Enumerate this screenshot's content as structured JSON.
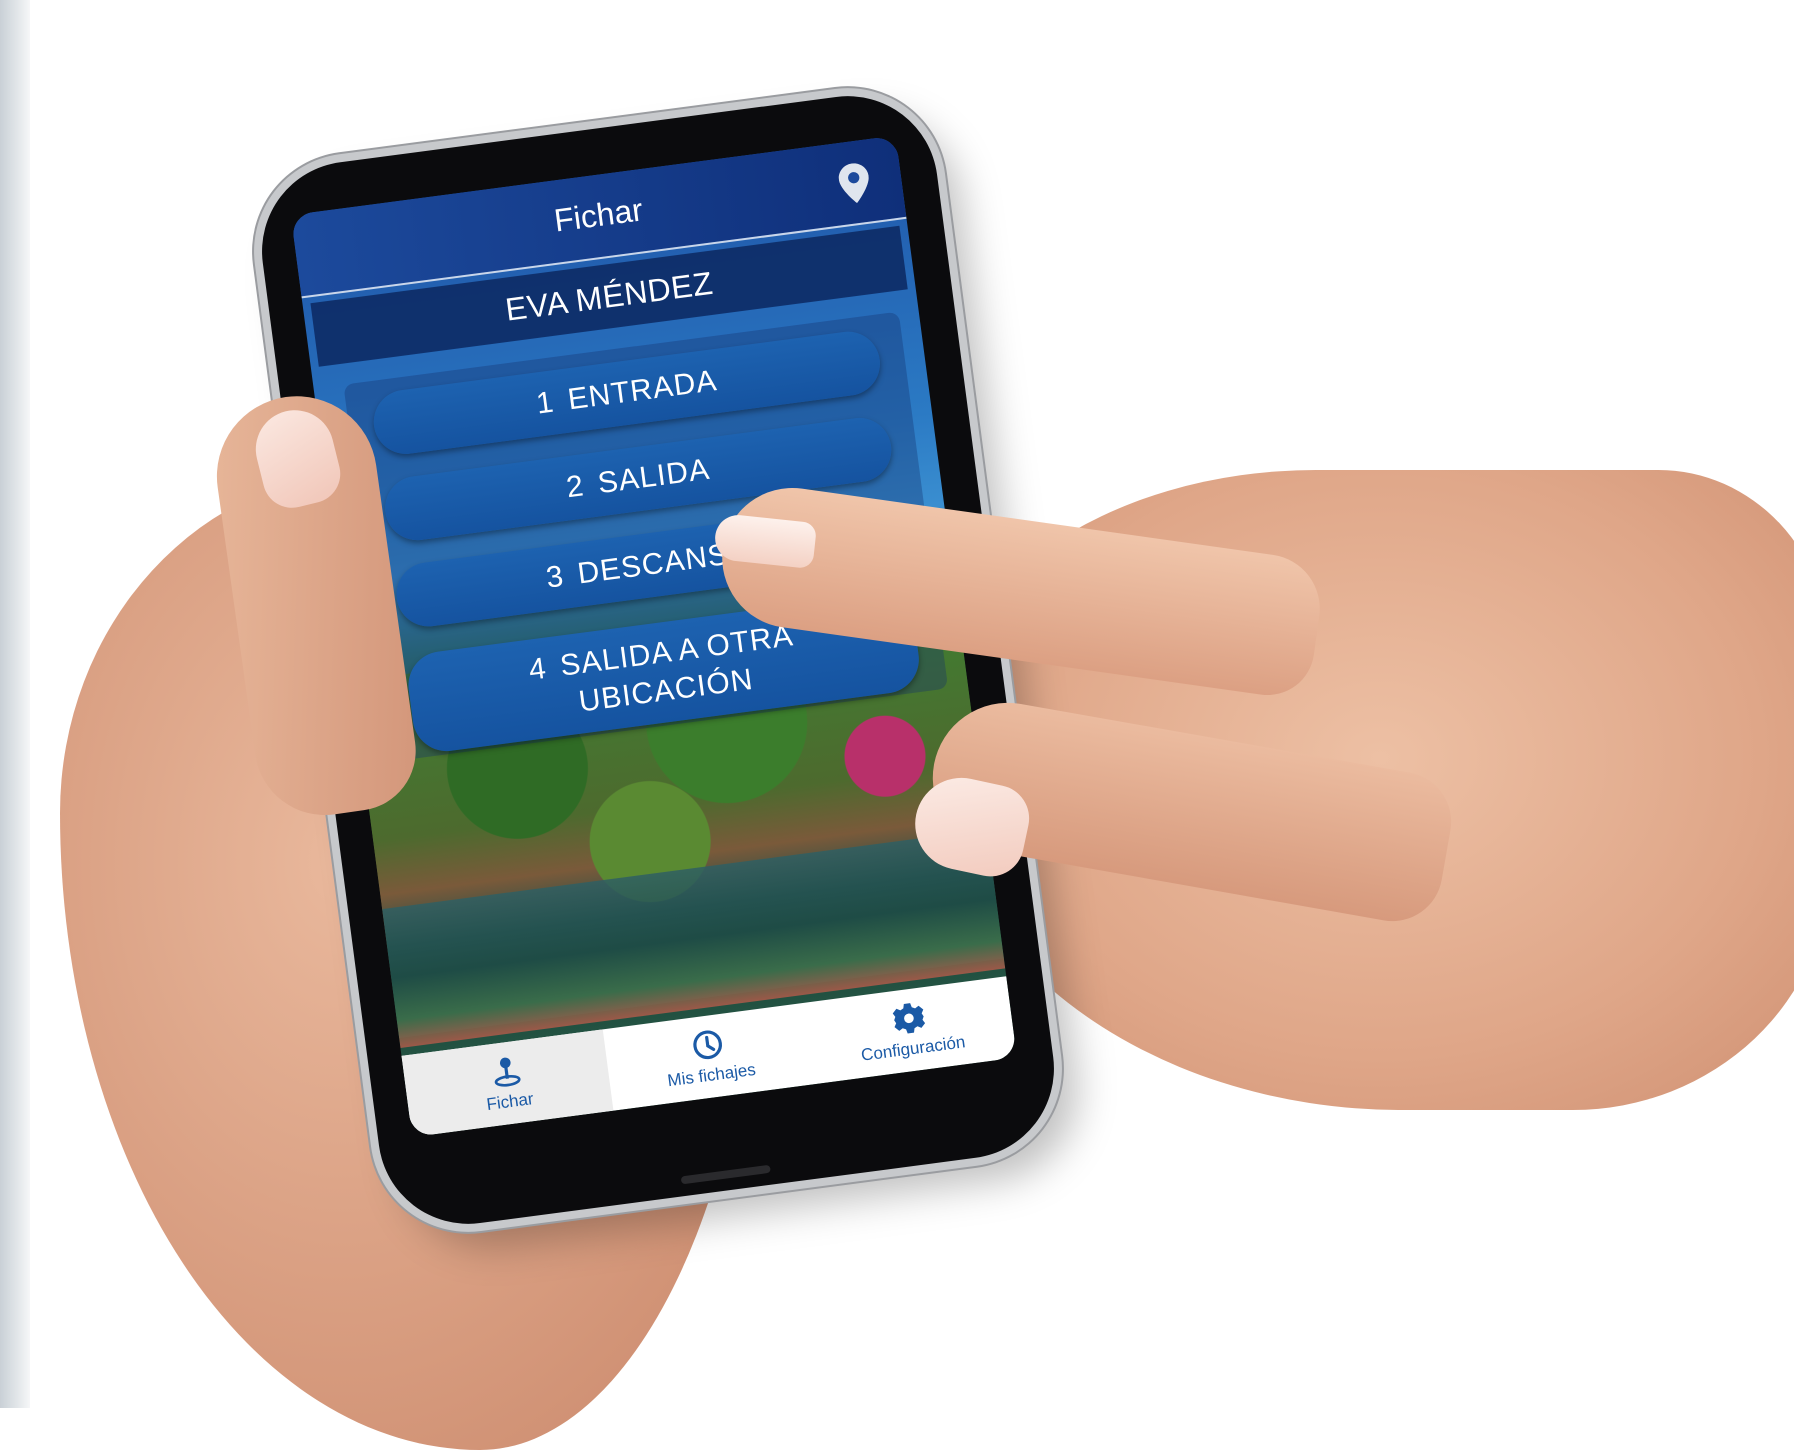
{
  "header": {
    "title": "Fichar",
    "location_icon": "location-pin-icon"
  },
  "user": {
    "name": "EVA MÉNDEZ"
  },
  "menu": {
    "items": [
      {
        "number": "1",
        "label": "ENTRADA"
      },
      {
        "number": "2",
        "label": "SALIDA"
      },
      {
        "number": "3",
        "label": "DESCANSO"
      },
      {
        "number": "4",
        "label_line1": "SALIDA A OTRA",
        "label_line2": "UBICACIÓN"
      }
    ]
  },
  "bottom_nav": {
    "items": [
      {
        "label": "Fichar",
        "icon": "location-person-icon",
        "active": true
      },
      {
        "label": "Mis fichajes",
        "icon": "clock-icon",
        "active": false
      },
      {
        "label": "Configuración",
        "icon": "gear-icon",
        "active": false
      }
    ]
  },
  "colors": {
    "header_blue": "#1c4a9c",
    "button_blue": "#1d62b0",
    "nav_text": "#1b5aa6"
  }
}
